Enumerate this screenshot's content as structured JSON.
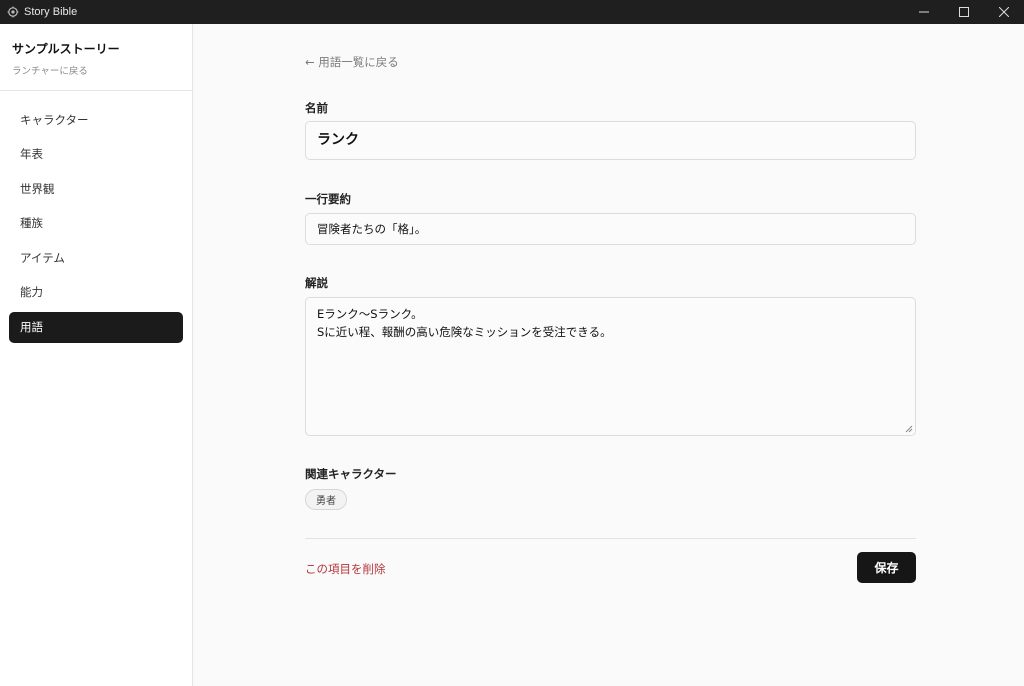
{
  "window": {
    "title": "Story Bible"
  },
  "sidebar": {
    "project_title": "サンプルストーリー",
    "launcher_link": "ランチャーに戻る",
    "items": [
      {
        "label": "キャラクター",
        "active": false
      },
      {
        "label": "年表",
        "active": false
      },
      {
        "label": "世界観",
        "active": false
      },
      {
        "label": "種族",
        "active": false
      },
      {
        "label": "アイテム",
        "active": false
      },
      {
        "label": "能力",
        "active": false
      },
      {
        "label": "用語",
        "active": true
      }
    ]
  },
  "main": {
    "back_link": "← 用語一覧に戻る",
    "name_label": "名前",
    "name_value": "ランク",
    "summary_label": "一行要約",
    "summary_value": "冒険者たちの「格」。",
    "description_label": "解説",
    "description_value": "Eランク〜Sランク。\nSに近い程、報酬の高い危険なミッションを受注できる。",
    "related_label": "関連キャラクター",
    "related_characters": [
      "勇者"
    ],
    "delete_label": "この項目を削除",
    "save_label": "保存"
  },
  "colors": {
    "titlebar": "#1f1f1f",
    "active_nav": "#1b1b1b",
    "delete": "#b5363b",
    "save_button": "#161616"
  }
}
